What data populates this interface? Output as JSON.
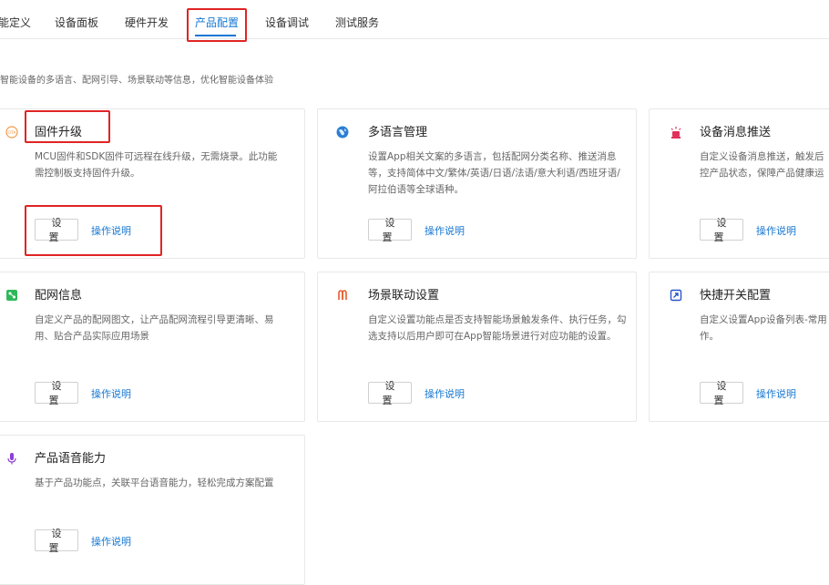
{
  "tabs": [
    {
      "label": "能定义"
    },
    {
      "label": "设备面板"
    },
    {
      "label": "硬件开发"
    },
    {
      "label": "产品配置"
    },
    {
      "label": "设备调试"
    },
    {
      "label": "测试服务"
    }
  ],
  "active_tab_index": 3,
  "page_description": "智能设备的多语言、配网引导、场景联动等信息，优化智能设备体验",
  "colors": {
    "accent": "#1677d2",
    "highlight": "#e02424"
  },
  "cards": [
    {
      "icon": "ota-icon",
      "title": "固件升级",
      "text": "MCU固件和SDK固件可远程在线升级，无需烧录。此功能需控制板支持固件升级。",
      "button": "设置",
      "link": "操作说明"
    },
    {
      "icon": "globe-icon",
      "title": "多语言管理",
      "text": "设置App相关文案的多语言，包括配网分类名称、推送消息等，支持简体中文/繁体/英语/日语/法语/意大利语/西班牙语/阿拉伯语等全球语种。",
      "button": "设置",
      "link": "操作说明"
    },
    {
      "icon": "alarm-light-icon",
      "title": "设备消息推送",
      "text": "自定义设备消息推送，触发后控产品状态，保障产品健康运",
      "button": "设置",
      "link": "操作说明"
    },
    {
      "icon": "network-icon",
      "title": "配网信息",
      "text": "自定义产品的配网图文，让产品配网流程引导更清晰、易用、贴合产品实际应用场景",
      "button": "设置",
      "link": "操作说明"
    },
    {
      "icon": "scene-link-icon",
      "title": "场景联动设置",
      "text": "自定义设置功能点是否支持智能场景触发条件、执行任务，勾选支持以后用户即可在App智能场景进行对应功能的设置。",
      "button": "设置",
      "link": "操作说明"
    },
    {
      "icon": "shortcut-icon",
      "title": "快捷开关配置",
      "text": "自定义设置App设备列表-常用作。",
      "button": "设置",
      "link": "操作说明"
    },
    {
      "icon": "microphone-icon",
      "title": "产品语音能力",
      "text": "基于产品功能点，关联平台语音能力，轻松完成方案配置",
      "button": "设置",
      "link": "操作说明"
    }
  ]
}
